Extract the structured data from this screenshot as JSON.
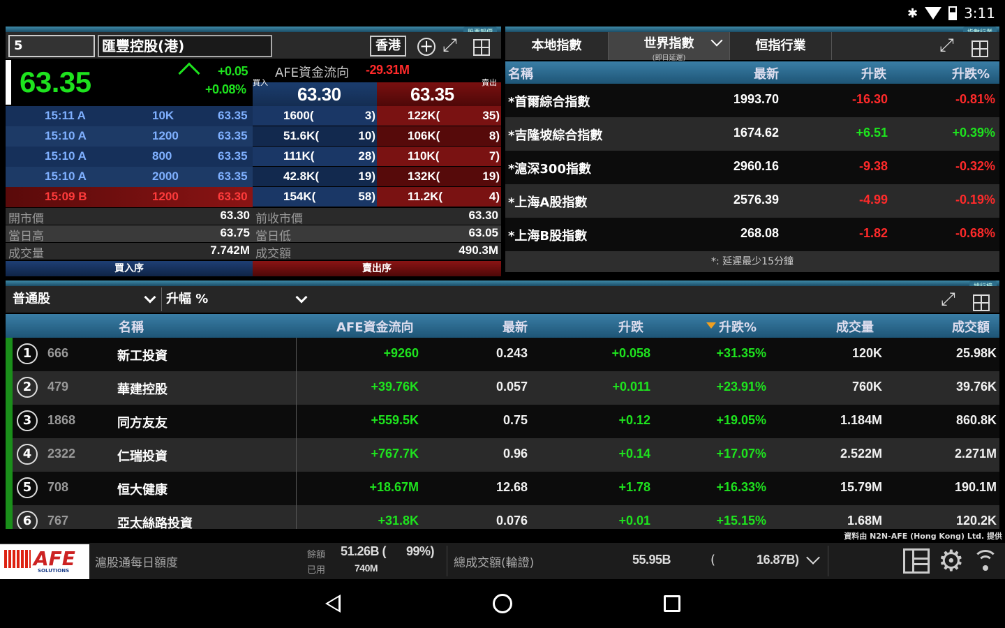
{
  "status_bar": {
    "time": "3:11",
    "icons": [
      "bluetooth-icon",
      "wifi-icon",
      "battery-icon"
    ]
  },
  "quote_panel": {
    "tag": "股票報價",
    "code": "5",
    "name": "匯豐控股(港)",
    "market_btn": "香港",
    "price": "63.35",
    "change": "+0.05",
    "change_pct": "+0.08%",
    "afe_label": "AFE資金流向",
    "afe_value": "-29.31M",
    "bid_label": "買入",
    "ask_label": "賣出",
    "bid_price": "63.30",
    "ask_price": "63.35",
    "trades": [
      {
        "time": "15:11 A",
        "vol": "10K",
        "price": "63.35",
        "type": "up"
      },
      {
        "time": "15:10 A",
        "vol": "1200",
        "price": "63.35",
        "type": "up"
      },
      {
        "time": "15:10 A",
        "vol": "800",
        "price": "63.35",
        "type": "up"
      },
      {
        "time": "15:10 A",
        "vol": "2000",
        "price": "63.35",
        "type": "up"
      },
      {
        "time": "15:09 B",
        "vol": "1200",
        "price": "63.30",
        "type": "down"
      }
    ],
    "bid_queue": [
      {
        "vol": "1600(",
        "cnt": "3)"
      },
      {
        "vol": "51.6K(",
        "cnt": "10)"
      },
      {
        "vol": "111K(",
        "cnt": "28)"
      },
      {
        "vol": "42.8K(",
        "cnt": "19)"
      },
      {
        "vol": "154K(",
        "cnt": "58)"
      }
    ],
    "ask_queue": [
      {
        "vol": "122K(",
        "cnt": "35)"
      },
      {
        "vol": "106K(",
        "cnt": "8)"
      },
      {
        "vol": "110K(",
        "cnt": "7)"
      },
      {
        "vol": "132K(",
        "cnt": "19)"
      },
      {
        "vol": "11.2K(",
        "cnt": "4)"
      }
    ],
    "stats": [
      {
        "l_label": "開市價",
        "l_value": "63.30",
        "r_label": "前收市價",
        "r_value": "63.30"
      },
      {
        "l_label": "當日高",
        "l_value": "63.75",
        "r_label": "當日低",
        "r_value": "63.05"
      },
      {
        "l_label": "成交量",
        "l_value": "7.742M",
        "r_label": "成交額",
        "r_value": "490.3M"
      }
    ],
    "buy_queue_label": "買入序",
    "sell_queue_label": "賣出序"
  },
  "index_panel": {
    "tag": "指數行業",
    "tabs": [
      {
        "label": "本地指數"
      },
      {
        "label": "世界指數",
        "sub": "(即日延遲)"
      },
      {
        "label": "恒指行業"
      }
    ],
    "headers": [
      "名稱",
      "最新",
      "升跌",
      "升跌%"
    ],
    "rows": [
      {
        "name": "*首爾綜合指數",
        "last": "1993.70",
        "chg": "-16.30",
        "pct": "-0.81%",
        "dir": "down"
      },
      {
        "name": "*吉隆坡綜合指數",
        "last": "1674.62",
        "chg": "+6.51",
        "pct": "+0.39%",
        "dir": "up"
      },
      {
        "name": "*滬深300指數",
        "last": "2960.16",
        "chg": "-9.38",
        "pct": "-0.32%",
        "dir": "down"
      },
      {
        "name": "*上海A股指數",
        "last": "2576.39",
        "chg": "-4.99",
        "pct": "-0.19%",
        "dir": "down"
      },
      {
        "name": "*上海B股指數",
        "last": "268.08",
        "chg": "-1.82",
        "pct": "-0.68%",
        "dir": "down"
      }
    ],
    "footnote": "*: 延遲最少15分鐘"
  },
  "ranking_panel": {
    "tag": "排行榜",
    "filter1": "普通股",
    "filter2": "升幅 %",
    "headers": [
      "名稱",
      "AFE資金流向",
      "最新",
      "升跌",
      "升跌%",
      "成交量",
      "成交額"
    ],
    "rows": [
      {
        "rank": "1",
        "code": "666",
        "name": "新工投資",
        "afe": "+9260",
        "last": "0.243",
        "chg": "+0.058",
        "pct": "+31.35%",
        "vol": "120K",
        "turnover": "25.98K"
      },
      {
        "rank": "2",
        "code": "479",
        "name": "華建控股",
        "afe": "+39.76K",
        "last": "0.057",
        "chg": "+0.011",
        "pct": "+23.91%",
        "vol": "760K",
        "turnover": "39.76K"
      },
      {
        "rank": "3",
        "code": "1868",
        "name": "同方友友",
        "afe": "+559.5K",
        "last": "0.75",
        "chg": "+0.12",
        "pct": "+19.05%",
        "vol": "1.184M",
        "turnover": "860.8K"
      },
      {
        "rank": "4",
        "code": "2322",
        "name": "仁瑞投資",
        "afe": "+767.7K",
        "last": "0.96",
        "chg": "+0.14",
        "pct": "+17.07%",
        "vol": "2.522M",
        "turnover": "2.271M"
      },
      {
        "rank": "5",
        "code": "708",
        "name": "恒大健康",
        "afe": "+18.67M",
        "last": "12.68",
        "chg": "+1.78",
        "pct": "+16.33%",
        "vol": "15.79M",
        "turnover": "190.1M"
      },
      {
        "rank": "6",
        "code": "767",
        "name": "亞太絲路投資",
        "afe": "+31.8K",
        "last": "0.076",
        "chg": "+0.01",
        "pct": "+15.15%",
        "vol": "1.68M",
        "turnover": "120.2K"
      }
    ],
    "source": "資料由 N2N-AFE (Hong Kong) Ltd. 提供"
  },
  "bottom_bar": {
    "logo": "AFE",
    "logo_sub": "SOLUTIONS",
    "quota_label": "滬股通每日額度",
    "remain_label": "餘額",
    "used_label": "已用",
    "remain_value": "51.26B (",
    "remain_pct": "99%)",
    "used_value": "740M",
    "total_label": "總成交額(輪證)",
    "total_value": "55.95B",
    "paren_open": "(",
    "warrant_value": "16.87B)"
  },
  "nav_bar": {
    "icons": [
      "back-icon",
      "home-icon",
      "recents-icon"
    ]
  }
}
